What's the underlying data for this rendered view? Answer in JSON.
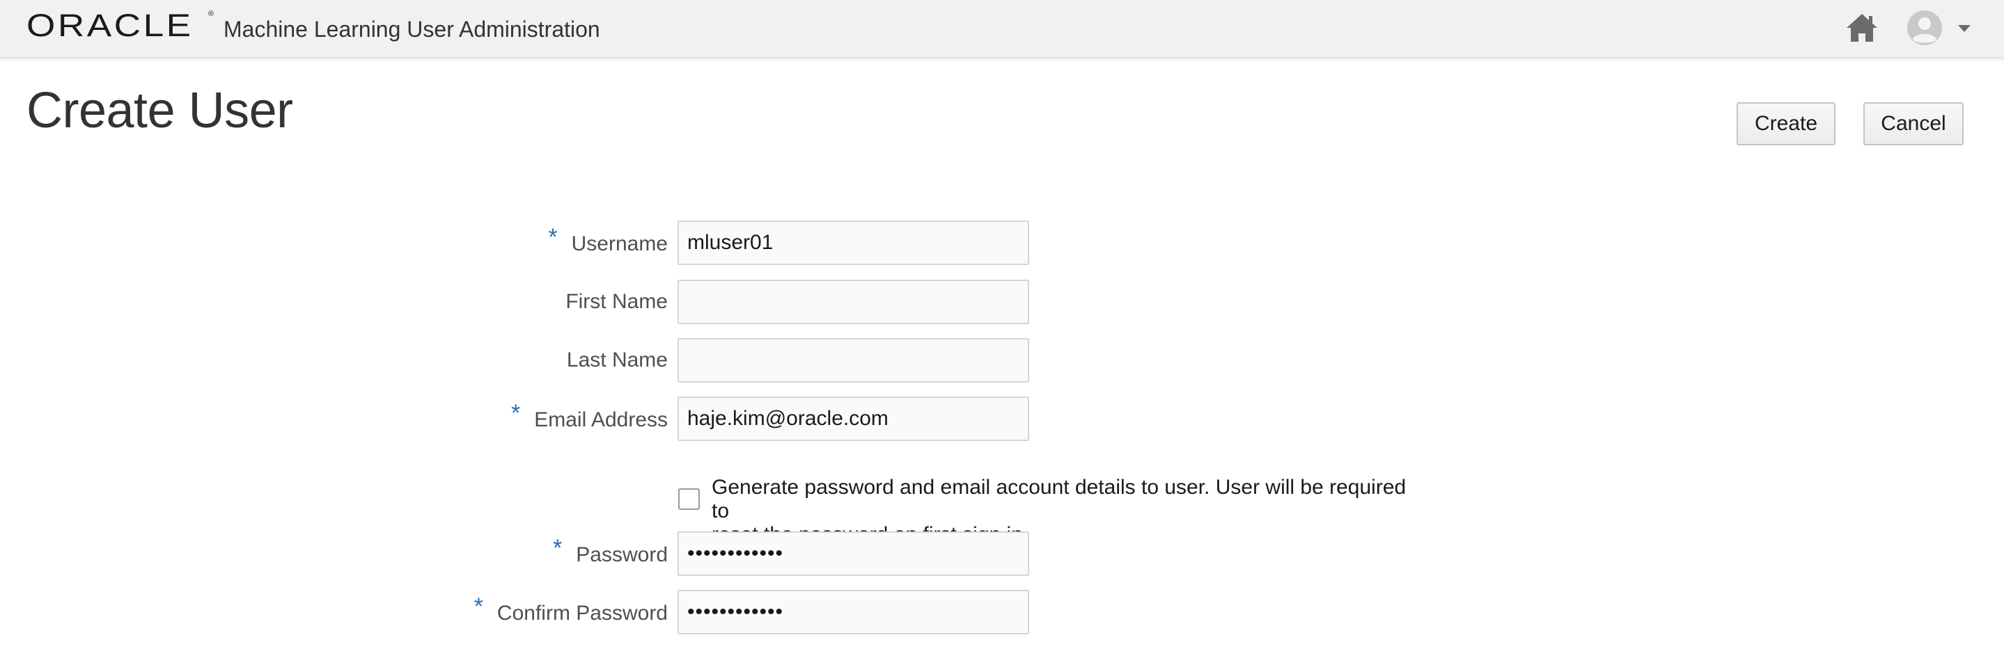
{
  "header": {
    "brand": "ORACLE",
    "brand_mark": "®",
    "app_title": "Machine Learning User Administration",
    "home_icon": "home-icon",
    "user_icon": "user-avatar-icon",
    "menu_icon": "caret-down-icon"
  },
  "page": {
    "title": "Create User"
  },
  "actions": {
    "create_label": "Create",
    "cancel_label": "Cancel"
  },
  "form": {
    "required_marker": "*",
    "username": {
      "label": "Username",
      "value": "mluser01",
      "required": true
    },
    "first_name": {
      "label": "First Name",
      "value": "",
      "required": false
    },
    "last_name": {
      "label": "Last Name",
      "value": "",
      "required": false
    },
    "email": {
      "label": "Email Address",
      "value": "haje.kim@oracle.com",
      "required": true
    },
    "generate_password": {
      "checked": false,
      "line1": "Generate password and email account details to user. User will be required to",
      "line2": "reset the password on first sign in."
    },
    "password": {
      "label": "Password",
      "value": "••••••••••••",
      "required": true
    },
    "confirm_password": {
      "label": "Confirm Password",
      "value": "••••••••••••",
      "required": true
    }
  },
  "colors": {
    "header_bg": "#f1f1f1",
    "required_marker": "#2a6fb0",
    "button_border": "#c4c4c4",
    "input_border": "#d6d6d6"
  }
}
